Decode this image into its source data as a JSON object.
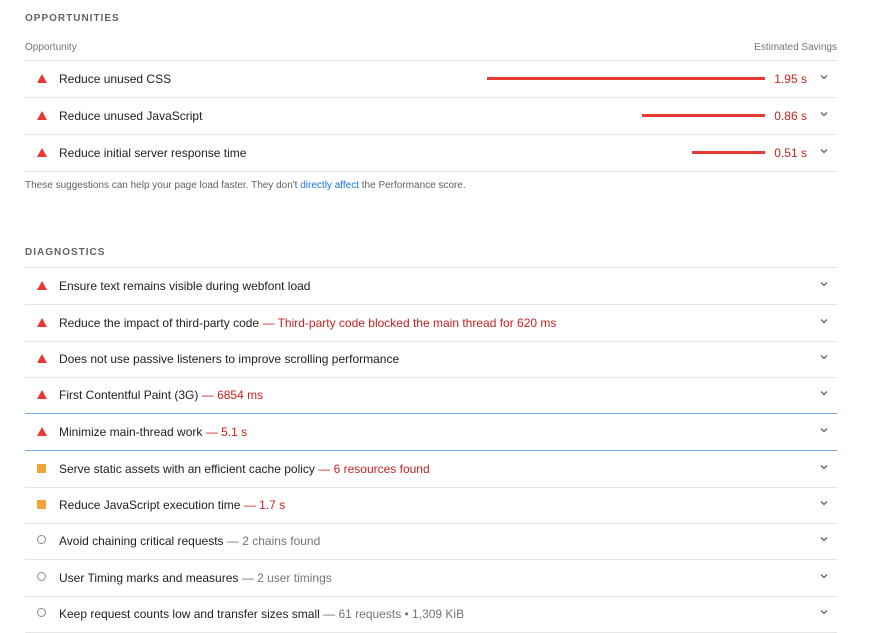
{
  "opportunities": {
    "title": "OPPORTUNITIES",
    "column_left": "Opportunity",
    "column_right": "Estimated Savings",
    "items": [
      {
        "label": "Reduce unused CSS",
        "savings": "1.95 s",
        "savings_value_s": 1.95
      },
      {
        "label": "Reduce unused JavaScript",
        "savings": "0.86 s",
        "savings_value_s": 0.86
      },
      {
        "label": "Reduce initial server response time",
        "savings": "0.51 s",
        "savings_value_s": 0.51
      }
    ],
    "note_before": "These suggestions can help your page load faster. They don't",
    "note_link": "directly affect",
    "note_after": "the Performance score."
  },
  "diagnostics": {
    "title": "DIAGNOSTICS",
    "items": [
      {
        "status": "fail",
        "label": "Ensure text remains visible during webfont load",
        "display": ""
      },
      {
        "status": "fail",
        "label": "Reduce the impact of third-party code",
        "display": "Third-party code blocked the main thread for 620 ms"
      },
      {
        "status": "fail",
        "label": "Does not use passive listeners to improve scrolling performance",
        "display": ""
      },
      {
        "status": "fail",
        "label": "First Contentful Paint (3G)",
        "display": "6854 ms"
      },
      {
        "status": "fail",
        "label": "Minimize main-thread work",
        "display": "5.1 s"
      },
      {
        "status": "average",
        "label": "Serve static assets with an efficient cache policy",
        "display": "6 resources found"
      },
      {
        "status": "average",
        "label": "Reduce JavaScript execution time",
        "display": "1.7 s"
      },
      {
        "status": "pass",
        "label": "Avoid chaining critical requests",
        "display": "2 chains found"
      },
      {
        "status": "pass",
        "label": "User Timing marks and measures",
        "display": "2 user timings"
      },
      {
        "status": "pass",
        "label": "Keep request counts low and transfer sizes small",
        "display": "61 requests • 1,309 KiB"
      }
    ]
  },
  "separator": "—",
  "colors": {
    "fail": "#e53935",
    "fail_text": "#c5221f",
    "average": "#f0a33a",
    "pass_outline": "#8a8a8a",
    "link": "#1a73e8",
    "selected_border": "#7aa7e9"
  }
}
